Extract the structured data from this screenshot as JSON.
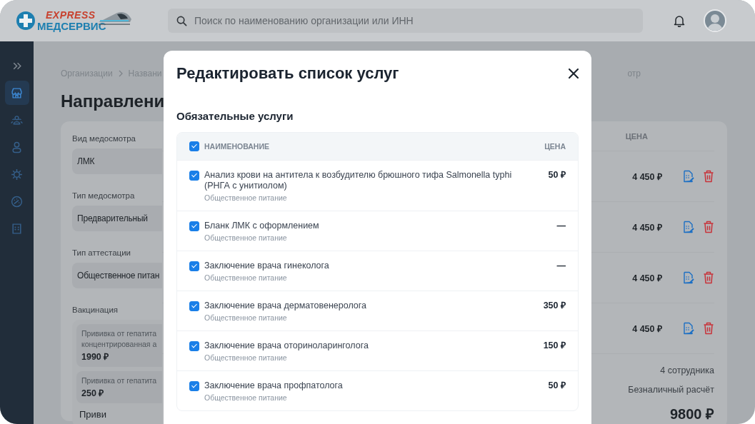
{
  "header": {
    "logo": {
      "top": "EXPRESS",
      "bottom": "МЕДСЕРВИС"
    },
    "search": {
      "placeholder": "Поиск по наименованию организации или ИНН"
    }
  },
  "sidebar": {
    "items": [
      {
        "selected": false
      },
      {
        "selected": true
      },
      {
        "selected": false
      },
      {
        "selected": false
      },
      {
        "selected": false
      },
      {
        "selected": false
      },
      {
        "selected": false
      }
    ]
  },
  "page": {
    "breadcrumbs": [
      "Организации",
      "Названи"
    ],
    "breadcrumb_tail": "отр",
    "title": "Направлени",
    "form": [
      {
        "label": "Вид медосмотра",
        "value": "ЛМК"
      },
      {
        "label": "Тип медосмотра",
        "value": "Предварительный"
      },
      {
        "label": "Тип аттестации",
        "value": "Общественное питан"
      }
    ],
    "vaccination": {
      "label": "Вакцинация",
      "items": [
        {
          "lines": [
            "Прививка от гепатита",
            "концентрированная а"
          ],
          "price": "1990 ₽"
        },
        {
          "lines": [
            "Прививка от гепатита"
          ],
          "price": "250 ₽"
        }
      ],
      "partial": "Приви"
    },
    "table": {
      "price_column": "ЦЕНА",
      "rows": [
        {
          "price": "4 450 ₽"
        },
        {
          "price": "4 450 ₽"
        },
        {
          "price": "4 450 ₽"
        },
        {
          "price": "4 450 ₽"
        }
      ]
    },
    "summary": {
      "employees": "4 сотрудника",
      "payment": "Безналичный расчёт",
      "total": "9800 ₽"
    }
  },
  "modal": {
    "title": "Редактировать список услуг",
    "section": "Обязательные услуги",
    "columns": [
      "НАИМЕНОВАНИЕ",
      "ЦЕНА"
    ],
    "all_checked": true,
    "rows": [
      {
        "name": "Анализ крови на антитела к возбудителю брюшного тифа Salmonella typhi (РНГА с унитиолом)",
        "category": "Общественное питание",
        "price": "50 ₽",
        "checked": true
      },
      {
        "name": "Бланк ЛМК с оформлением",
        "category": "Общественное питание",
        "price": "—",
        "checked": true
      },
      {
        "name": "Заключение врача гинеколога",
        "category": "Общественное питание",
        "price": "—",
        "checked": true
      },
      {
        "name": "Заключение врача дерматовенеролога",
        "category": "Общественное питание",
        "price": "350 ₽",
        "checked": true
      },
      {
        "name": "Заключение врача оториноларинголога",
        "category": "Общественное питание",
        "price": "150 ₽",
        "checked": true
      },
      {
        "name": "Заключение врача профпатолога",
        "category": "Общественное питание",
        "price": "50 ₽",
        "checked": true
      }
    ]
  }
}
